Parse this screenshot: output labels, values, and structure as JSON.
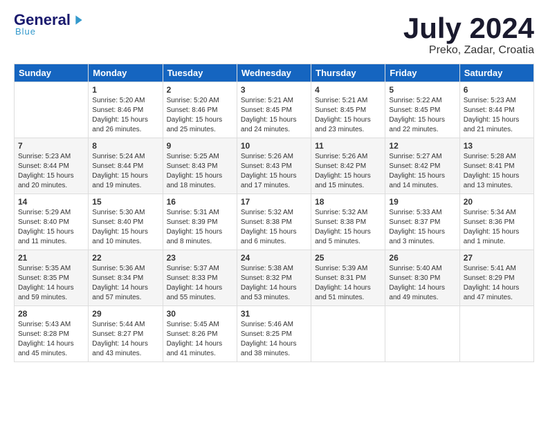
{
  "header": {
    "logo_general": "General",
    "logo_blue": "Blue",
    "logo_sub": "Blue",
    "month_year": "July 2024",
    "location": "Preko, Zadar, Croatia"
  },
  "days_of_week": [
    "Sunday",
    "Monday",
    "Tuesday",
    "Wednesday",
    "Thursday",
    "Friday",
    "Saturday"
  ],
  "weeks": [
    [
      {
        "day": "",
        "info": ""
      },
      {
        "day": "1",
        "info": "Sunrise: 5:20 AM\nSunset: 8:46 PM\nDaylight: 15 hours\nand 26 minutes."
      },
      {
        "day": "2",
        "info": "Sunrise: 5:20 AM\nSunset: 8:46 PM\nDaylight: 15 hours\nand 25 minutes."
      },
      {
        "day": "3",
        "info": "Sunrise: 5:21 AM\nSunset: 8:45 PM\nDaylight: 15 hours\nand 24 minutes."
      },
      {
        "day": "4",
        "info": "Sunrise: 5:21 AM\nSunset: 8:45 PM\nDaylight: 15 hours\nand 23 minutes."
      },
      {
        "day": "5",
        "info": "Sunrise: 5:22 AM\nSunset: 8:45 PM\nDaylight: 15 hours\nand 22 minutes."
      },
      {
        "day": "6",
        "info": "Sunrise: 5:23 AM\nSunset: 8:44 PM\nDaylight: 15 hours\nand 21 minutes."
      }
    ],
    [
      {
        "day": "7",
        "info": "Sunrise: 5:23 AM\nSunset: 8:44 PM\nDaylight: 15 hours\nand 20 minutes."
      },
      {
        "day": "8",
        "info": "Sunrise: 5:24 AM\nSunset: 8:44 PM\nDaylight: 15 hours\nand 19 minutes."
      },
      {
        "day": "9",
        "info": "Sunrise: 5:25 AM\nSunset: 8:43 PM\nDaylight: 15 hours\nand 18 minutes."
      },
      {
        "day": "10",
        "info": "Sunrise: 5:26 AM\nSunset: 8:43 PM\nDaylight: 15 hours\nand 17 minutes."
      },
      {
        "day": "11",
        "info": "Sunrise: 5:26 AM\nSunset: 8:42 PM\nDaylight: 15 hours\nand 15 minutes."
      },
      {
        "day": "12",
        "info": "Sunrise: 5:27 AM\nSunset: 8:42 PM\nDaylight: 15 hours\nand 14 minutes."
      },
      {
        "day": "13",
        "info": "Sunrise: 5:28 AM\nSunset: 8:41 PM\nDaylight: 15 hours\nand 13 minutes."
      }
    ],
    [
      {
        "day": "14",
        "info": "Sunrise: 5:29 AM\nSunset: 8:40 PM\nDaylight: 15 hours\nand 11 minutes."
      },
      {
        "day": "15",
        "info": "Sunrise: 5:30 AM\nSunset: 8:40 PM\nDaylight: 15 hours\nand 10 minutes."
      },
      {
        "day": "16",
        "info": "Sunrise: 5:31 AM\nSunset: 8:39 PM\nDaylight: 15 hours\nand 8 minutes."
      },
      {
        "day": "17",
        "info": "Sunrise: 5:32 AM\nSunset: 8:38 PM\nDaylight: 15 hours\nand 6 minutes."
      },
      {
        "day": "18",
        "info": "Sunrise: 5:32 AM\nSunset: 8:38 PM\nDaylight: 15 hours\nand 5 minutes."
      },
      {
        "day": "19",
        "info": "Sunrise: 5:33 AM\nSunset: 8:37 PM\nDaylight: 15 hours\nand 3 minutes."
      },
      {
        "day": "20",
        "info": "Sunrise: 5:34 AM\nSunset: 8:36 PM\nDaylight: 15 hours\nand 1 minute."
      }
    ],
    [
      {
        "day": "21",
        "info": "Sunrise: 5:35 AM\nSunset: 8:35 PM\nDaylight: 14 hours\nand 59 minutes."
      },
      {
        "day": "22",
        "info": "Sunrise: 5:36 AM\nSunset: 8:34 PM\nDaylight: 14 hours\nand 57 minutes."
      },
      {
        "day": "23",
        "info": "Sunrise: 5:37 AM\nSunset: 8:33 PM\nDaylight: 14 hours\nand 55 minutes."
      },
      {
        "day": "24",
        "info": "Sunrise: 5:38 AM\nSunset: 8:32 PM\nDaylight: 14 hours\nand 53 minutes."
      },
      {
        "day": "25",
        "info": "Sunrise: 5:39 AM\nSunset: 8:31 PM\nDaylight: 14 hours\nand 51 minutes."
      },
      {
        "day": "26",
        "info": "Sunrise: 5:40 AM\nSunset: 8:30 PM\nDaylight: 14 hours\nand 49 minutes."
      },
      {
        "day": "27",
        "info": "Sunrise: 5:41 AM\nSunset: 8:29 PM\nDaylight: 14 hours\nand 47 minutes."
      }
    ],
    [
      {
        "day": "28",
        "info": "Sunrise: 5:43 AM\nSunset: 8:28 PM\nDaylight: 14 hours\nand 45 minutes."
      },
      {
        "day": "29",
        "info": "Sunrise: 5:44 AM\nSunset: 8:27 PM\nDaylight: 14 hours\nand 43 minutes."
      },
      {
        "day": "30",
        "info": "Sunrise: 5:45 AM\nSunset: 8:26 PM\nDaylight: 14 hours\nand 41 minutes."
      },
      {
        "day": "31",
        "info": "Sunrise: 5:46 AM\nSunset: 8:25 PM\nDaylight: 14 hours\nand 38 minutes."
      },
      {
        "day": "",
        "info": ""
      },
      {
        "day": "",
        "info": ""
      },
      {
        "day": "",
        "info": ""
      }
    ]
  ]
}
